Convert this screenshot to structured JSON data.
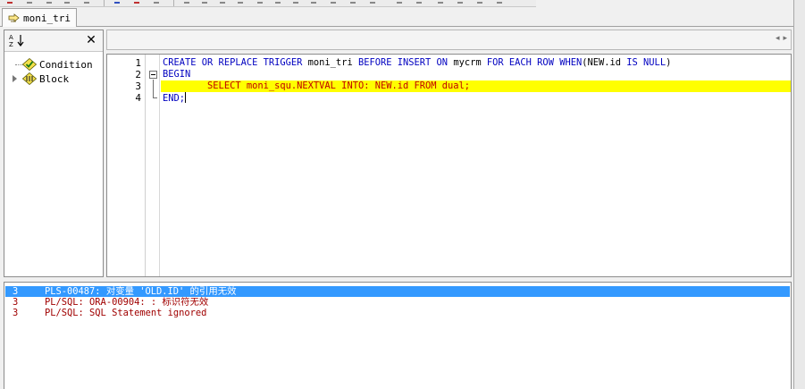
{
  "tabs": [
    {
      "label": "moni_tri",
      "icon": "trigger-icon",
      "active": true
    }
  ],
  "left_panel": {
    "sort_button": {
      "icon": "sort-az-icon"
    },
    "close_button": {
      "label": "✕",
      "icon": "close-icon"
    },
    "tree": [
      {
        "label": "Condition",
        "icon": "condition-check-icon",
        "expandable": false
      },
      {
        "label": "Block",
        "icon": "block-icon",
        "expandable": true
      }
    ]
  },
  "address_bar": {
    "arrows": [
      "◂",
      "▸"
    ]
  },
  "editor": {
    "line_numbers": [
      "1",
      "2",
      "3",
      "4"
    ],
    "lines": [
      {
        "tokens": [
          {
            "text": "CREATE OR REPLACE TRIGGER ",
            "kind": "kw"
          },
          {
            "text": "moni_tri ",
            "kind": "id"
          },
          {
            "text": "BEFORE INSERT ON ",
            "kind": "kw"
          },
          {
            "text": "mycrm ",
            "kind": "id"
          },
          {
            "text": "FOR EACH ROW WHEN",
            "kind": "kw"
          },
          {
            "text": "(NEW.id ",
            "kind": "id"
          },
          {
            "text": "IS NULL",
            "kind": "kw"
          },
          {
            "text": ")",
            "kind": "id"
          }
        ]
      },
      {
        "tokens": [
          {
            "text": "BEGIN",
            "kind": "kw"
          }
        ]
      },
      {
        "highlighted": true,
        "tokens": [
          {
            "text": "        SELECT moni_squ.NEXTVAL INTO: NEW.id FROM dual;",
            "kind": "sel"
          }
        ]
      },
      {
        "tokens": [
          {
            "text": "END;",
            "kind": "kw"
          }
        ],
        "caret": true
      }
    ]
  },
  "messages": [
    {
      "line": "3",
      "text": "PLS-00487: 对变量 'OLD.ID' 的引用无效",
      "selected": true
    },
    {
      "line": "3",
      "text": "PL/SQL: ORA-00904: : 标识符无效",
      "selected": false
    },
    {
      "line": "3",
      "text": "PL/SQL: SQL Statement ignored",
      "selected": false
    }
  ],
  "colors": {
    "keyword": "#0000c0",
    "highlight_line": "#ffff00",
    "error_text": "#a00000",
    "selection": "#3399ff"
  }
}
